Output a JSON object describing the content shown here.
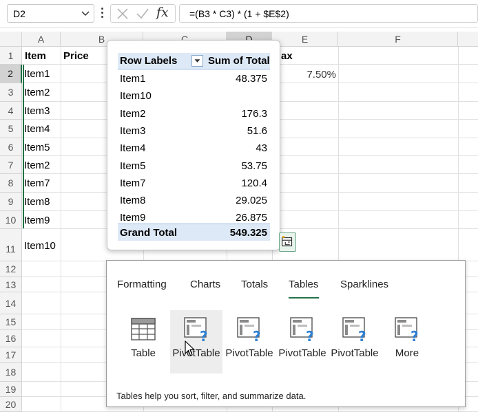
{
  "formula_bar": {
    "name_box": "D2",
    "formula": "=(B3 * C3) * (1 + $E$2)",
    "fx_label": "fx"
  },
  "columns": [
    "A",
    "B",
    "C",
    "D",
    "E",
    "F"
  ],
  "rows": [
    "1",
    "2",
    "3",
    "4",
    "5",
    "6",
    "7",
    "8",
    "9",
    "10",
    "11",
    "12",
    "13",
    "14",
    "15",
    "16",
    "17",
    "18",
    "19",
    "20"
  ],
  "cells": {
    "a1": "Item",
    "b1": "Price",
    "e1": "ax",
    "e2": "7.50%",
    "a_items": [
      "Item1",
      "Item2",
      "Item3",
      "Item4",
      "Item5",
      "Item2",
      "Item7",
      "Item8",
      "Item9",
      "Item10"
    ]
  },
  "pivot_preview": {
    "header_labels": "Row Labels",
    "header_sum": "Sum of Total",
    "rows": [
      {
        "label": "Item1",
        "value": "48.375"
      },
      {
        "label": "Item10",
        "value": ""
      },
      {
        "label": "Item2",
        "value": "176.3"
      },
      {
        "label": "Item3",
        "value": "51.6"
      },
      {
        "label": "Item4",
        "value": "43"
      },
      {
        "label": "Item5",
        "value": "53.75"
      },
      {
        "label": "Item7",
        "value": "120.4"
      },
      {
        "label": "Item8",
        "value": "29.025"
      },
      {
        "label": "Item9",
        "value": "26.875"
      }
    ],
    "grand_total_label": "Grand Total",
    "grand_total_value": "549.325"
  },
  "quick_analysis": {
    "tabs": [
      {
        "label": "Formatting"
      },
      {
        "label": "Charts"
      },
      {
        "label": "Totals"
      },
      {
        "label": "Tables"
      },
      {
        "label": "Sparklines"
      }
    ],
    "active_tab": "Tables",
    "items": [
      {
        "label": "Table",
        "icon": "table-icon"
      },
      {
        "label": "PivotTable",
        "icon": "pivot-table-icon"
      },
      {
        "label": "PivotTable",
        "icon": "pivot-table-icon"
      },
      {
        "label": "PivotTable",
        "icon": "pivot-table-icon"
      },
      {
        "label": "PivotTable",
        "icon": "pivot-table-icon"
      },
      {
        "label": "More",
        "icon": "more-pivot-icon"
      }
    ],
    "description": "Tables help you sort, filter, and summarize data."
  },
  "colors": {
    "accent": "#217346",
    "pivot_header": "#dde9f6",
    "icon_blue": "#2e7fd2"
  }
}
